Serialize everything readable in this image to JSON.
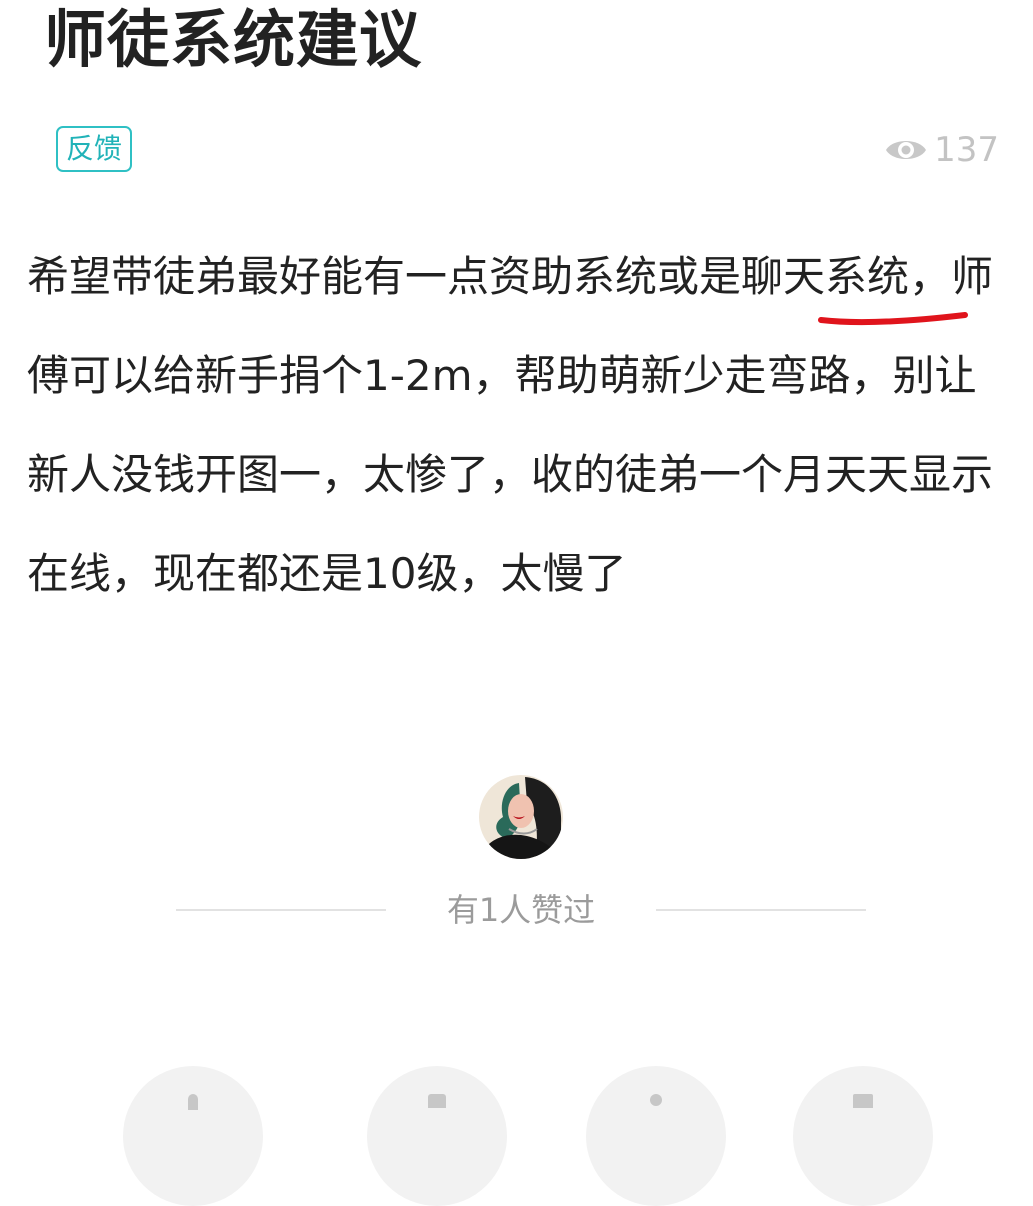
{
  "post": {
    "title": "师徒系统建议",
    "tag": "反馈",
    "views": "137",
    "body": "希望带徒弟最好能有一点资助系统或是聊天系统，师傅可以给新手捐个1-2m，帮助萌新少走弯路，别让新人没钱开图一，太惨了，收的徒弟一个月天天显示在线，现在都还是10级，太慢了"
  },
  "likes": {
    "text": "有1人赞过"
  },
  "colors": {
    "tag_accent": "#2fc0c4",
    "annotation": "#e0141c",
    "muted_text": "#9b9b9b"
  },
  "icons": {
    "views": "eye-icon",
    "actions": [
      "like-icon",
      "comment-icon",
      "user-icon",
      "bookmark-icon"
    ]
  }
}
